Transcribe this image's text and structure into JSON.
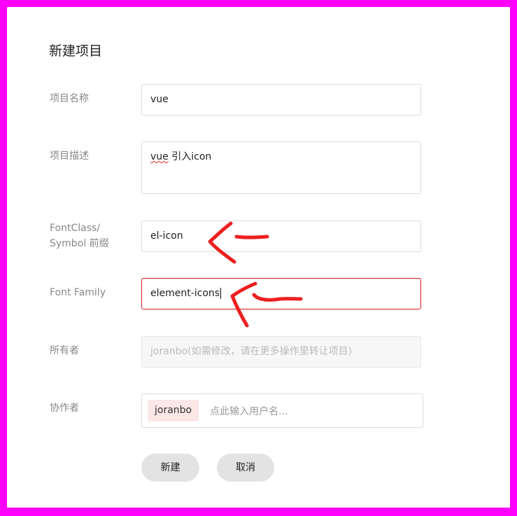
{
  "form": {
    "title": "新建项目",
    "fields": {
      "name": {
        "label": "项目名称",
        "value": "vue"
      },
      "description": {
        "label": "项目描述",
        "value_word": "vue",
        "value_rest": " 引入icon"
      },
      "prefix": {
        "label_line1": "FontClass/",
        "label_line2": "Symbol 前缀",
        "value": "el-icon"
      },
      "font_family": {
        "label": "Font Family",
        "value": "element-icons"
      },
      "owner": {
        "label": "所有者",
        "value": "joranbo(如需修改，请在更多操作里转让项目)"
      },
      "collaborators": {
        "label": "协作者",
        "tags": [
          "joranbo"
        ],
        "placeholder": "点此输入用户名..."
      }
    },
    "buttons": {
      "create": "新建",
      "cancel": "取消"
    }
  },
  "colors": {
    "frame": "#ff00ff",
    "focus_border": "#d9191a",
    "annotation_arrow": "#ee1f1f",
    "tag_bg": "#fbe7e6",
    "button_bg": "#e3e3e3"
  }
}
